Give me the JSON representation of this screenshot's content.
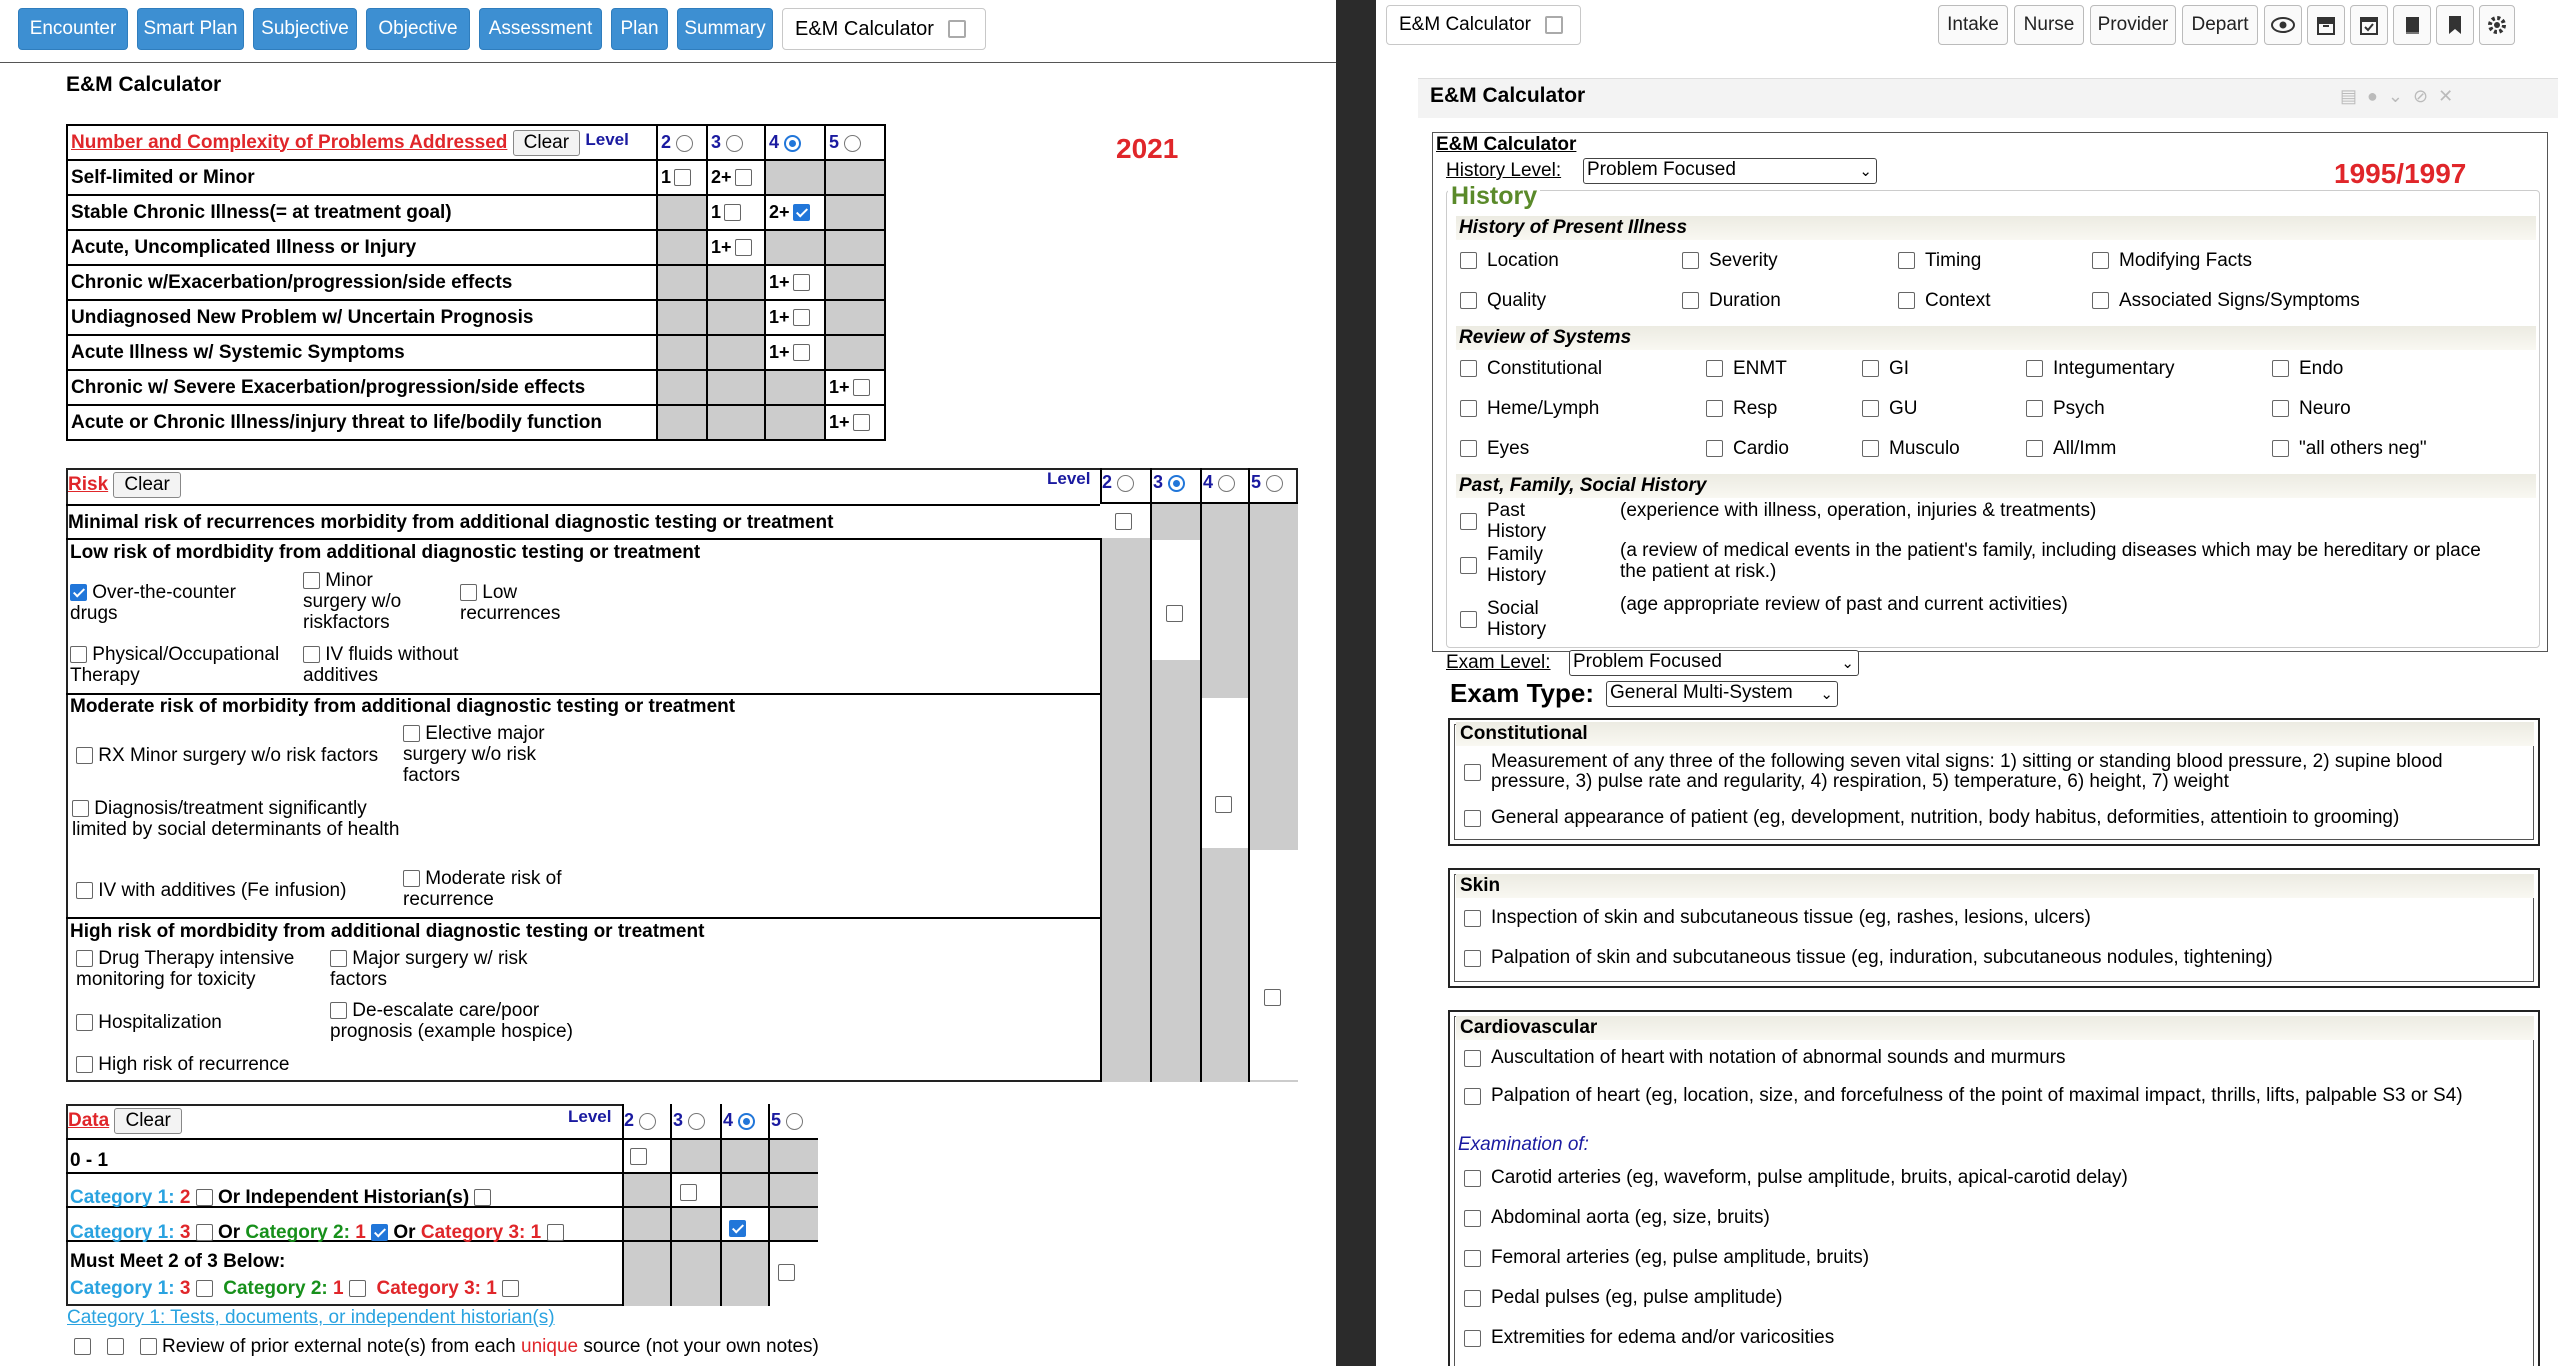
{
  "left": {
    "tabs": [
      "Encounter",
      "Smart Plan",
      "Subjective",
      "Objective",
      "Assessment",
      "Plan",
      "Summary"
    ],
    "active_tab": "E&M Calculator",
    "section_title": "E&M Calculator",
    "year": "2021",
    "problems": {
      "title": "Number and Complexity of Problems Addressed",
      "clear": "Clear",
      "level": "Level",
      "levels": [
        "2",
        "3",
        "4",
        "5"
      ],
      "selected_level": "4",
      "rows": [
        {
          "label": "Self-limited or Minor",
          "cells": [
            "1",
            "2+",
            "",
            ""
          ]
        },
        {
          "label": "Stable Chronic Illness(= at treatment goal)",
          "cells": [
            "",
            "1",
            "2+",
            ""
          ]
        },
        {
          "label": "Acute, Uncomplicated Illness or Injury",
          "cells": [
            "",
            "1+",
            "",
            ""
          ]
        },
        {
          "label": "Chronic w/Exacerbation/progression/side effects",
          "cells": [
            "",
            "",
            "1+",
            ""
          ]
        },
        {
          "label": "Undiagnosed New Problem w/ Uncertain Prognosis",
          "cells": [
            "",
            "",
            "1+",
            ""
          ]
        },
        {
          "label": "Acute Illness w/ Systemic Symptoms",
          "cells": [
            "",
            "",
            "1+",
            ""
          ]
        },
        {
          "label": "Chronic w/ Severe Exacerbation/progression/side effects",
          "cells": [
            "",
            "",
            "",
            "1+"
          ]
        },
        {
          "label": "Acute or Chronic Illness/injury threat to life/bodily function",
          "cells": [
            "",
            "",
            "",
            "1+"
          ]
        }
      ]
    },
    "risk": {
      "title": "Risk",
      "clear": "Clear",
      "level": "Level",
      "levels": [
        "2",
        "3",
        "4",
        "5"
      ],
      "selected_level": "3",
      "minimal": "Minimal risk of recurrences morbidity from additional diagnostic testing or treatment",
      "low": "Low risk of mordbidity from additional diagnostic testing or treatment",
      "low_items": [
        "Over-the-counter drugs",
        "Minor surgery w/o riskfactors",
        "Low recurrences",
        "Physical/Occupational Therapy",
        "IV fluids without additives"
      ],
      "moderate": "Moderate risk of morbidity from additional diagnostic testing or treatment",
      "moderate_items": [
        "RX Minor surgery w/o risk factors",
        "Elective major surgery w/o risk factors",
        "Diagnosis/treatment significantly limited by social determinants of health",
        "IV with additives (Fe infusion)",
        "Moderate risk of recurrence"
      ],
      "high": "High risk of mordbidity from additional diagnostic testing or treatment",
      "high_items": [
        "Drug Therapy intensive monitoring for toxicity",
        "Major surgery w/ risk factors",
        "Hospitalization",
        "De-escalate care/poor prognosis (example hospice)",
        "High risk of recurrence"
      ]
    },
    "data": {
      "title": "Data",
      "clear": "Clear",
      "level": "Level",
      "levels": [
        "2",
        "3",
        "4",
        "5"
      ],
      "selected_level": "4",
      "r1": "0 - 1",
      "r2a": "Category 1:",
      "r2b": "2",
      "r2c": "Or Independent Historian(s)",
      "r3a": "Category 1:",
      "r3b": "3",
      "r3c": "Or",
      "r3d": "Category 2:",
      "r3e": "1",
      "r3f": "Or",
      "r3g": "Category 3:",
      "r3h": "1",
      "r4": "Must Meet 2 of 3 Below:",
      "r4a": "Category 1:",
      "r4b": "3",
      "r4c": "Category 2:",
      "r4d": "1",
      "r4e": "Category 3:",
      "r4f": "1",
      "cat_link": "Category 1: Tests, documents, or independent historian(s)",
      "review": "Review of prior external note(s) from each",
      "review_red": "unique",
      "review_end": "source (not your own notes)"
    }
  },
  "right": {
    "tab": "E&M Calculator",
    "buttons": [
      "Intake",
      "Nurse",
      "Provider",
      "Depart"
    ],
    "panel_title": "E&M Calculator",
    "inner_title": "E&M Calculator",
    "year": "1995/1997",
    "history_level_label": "History Level:",
    "history_level": "Problem Focused",
    "history": "History",
    "hpi_title": "History of Present Illness",
    "hpi": [
      "Location",
      "Severity",
      "Timing",
      "Modifying Facts",
      "Quality",
      "Duration",
      "Context",
      "Associated Signs/Symptoms"
    ],
    "ros_title": "Review of Systems",
    "ros": [
      "Constitutional",
      "ENMT",
      "GI",
      "Integumentary",
      "Endo",
      "Heme/Lymph",
      "Resp",
      "GU",
      "Psych",
      "Neuro",
      "Eyes",
      "Cardio",
      "Musculo",
      "All/Imm",
      "\"all others neg\""
    ],
    "pfsh_title": "Past, Family, Social History",
    "pfsh": [
      {
        "label": "Past History",
        "desc": "(experience with illness, operation, injuries & treatments)"
      },
      {
        "label": "Family History",
        "desc": "(a review of medical events in the patient's family, including diseases which may be hereditary or place the patient at risk.)"
      },
      {
        "label": "Social History",
        "desc": "(age appropriate review of past and current activities)"
      }
    ],
    "exam_level_label": "Exam Level:",
    "exam_level": "Problem Focused",
    "exam_type_label": "Exam Type:",
    "exam_type": "General Multi-System",
    "constitutional_title": "Constitutional",
    "constitutional": [
      "Measurement of any three of the following seven vital signs: 1) sitting or standing blood pressure, 2) supine blood pressure, 3) pulse rate and regularity, 4) respiration, 5) temperature, 6) height, 7) weight",
      "General appearance of patient (eg, development, nutrition, body habitus, deformities, attentioin to grooming)"
    ],
    "skin_title": "Skin",
    "skin": [
      "Inspection of skin and subcutaneous tissue (eg, rashes, lesions, ulcers)",
      "Palpation of skin and subcutaneous tissue (eg, induration, subcutaneous nodules, tightening)"
    ],
    "cardio_title": "Cardiovascular",
    "cardio": [
      "Auscultation of heart with notation of abnormal sounds and murmurs",
      "Palpation of heart (eg, location, size, and forcefulness of the point of maximal impact, thrills, lifts, palpable S3 or S4)"
    ],
    "exam_of": "Examination of:",
    "cardio2": [
      "Carotid arteries (eg, waveform, pulse amplitude, bruits, apical-carotid delay)",
      "Abdominal aorta (eg, size, bruits)",
      "Femoral arteries (eg, pulse amplitude, bruits)",
      "Pedal pulses (eg, pulse amplitude)",
      "Extremities for edema and/or varicosities"
    ]
  }
}
